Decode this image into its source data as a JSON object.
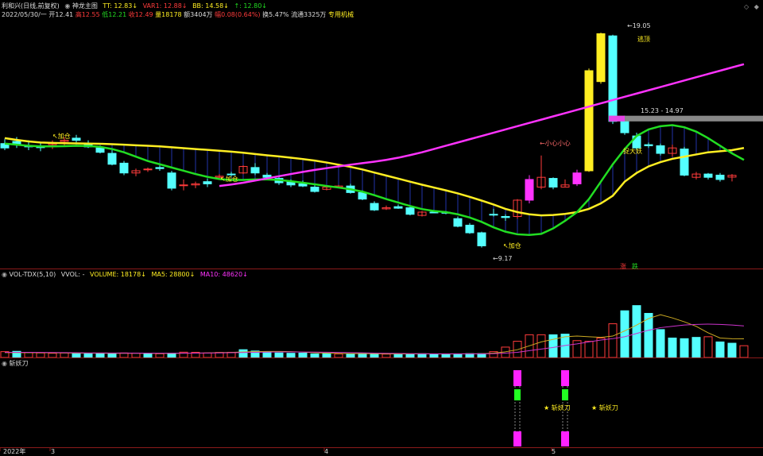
{
  "colors": {
    "up": "#ff3b3b",
    "down": "#54ffff",
    "ma_yellow": "#ffee22",
    "ma_green": "#22dd22",
    "ma_magenta": "#ff33ff",
    "white": "#dddddd",
    "orange": "#ffaa33",
    "gray": "#888888",
    "grid": "#8b1a1a"
  },
  "header": {
    "title": "利和兴(日线,前复权)",
    "indicator": "神龙主图",
    "tt": "TT: 12.83↓",
    "var1": "VAR1: 12.88↓",
    "bb": "BB: 14.58↓",
    "up_val": "↑: 12.80↓",
    "date": "2022/05/30/一",
    "open": "开12.41",
    "high": "高12.55",
    "low": "低12.21",
    "close": "收12.49",
    "vol": "量18178",
    "amount": "额3404万",
    "change": "幅0.08(0.64%)",
    "turnover": "换5.47%",
    "float": "流通3325万",
    "sector": "专用机械"
  },
  "window_icons": [
    "◇",
    "◆"
  ],
  "volume_header": {
    "name": "VOL-TDX(5,10)",
    "vvol": "VVOL: -",
    "volume": "VOLUME: 18178↓",
    "ma5": "MA5: 28800↓",
    "ma10": "MA10: 48620↓"
  },
  "signal_header": {
    "name": "斩妖刀"
  },
  "annotations": {
    "jiacang1": "↖加仓",
    "jiacang2": "↖加仓",
    "jiacang3": "↖加仓",
    "low_label": "←9.17",
    "high_label": "←19.05",
    "xiao_xin": "←小心小心",
    "taopao": "逃顶",
    "range_label": "15.23 - 14.97",
    "zhuo_da_yao": "捉大妖",
    "zhang": "涨",
    "die": "跌",
    "zhan1": "★ 斩妖刀",
    "zhan2": "★ 斩妖刀"
  },
  "x_axis": {
    "year": "2022年",
    "m3": "3",
    "m4": "4",
    "m5": "5"
  },
  "chart_data": [
    {
      "type": "candlestick",
      "title": "利和兴(日线,前复权)",
      "ylim": [
        8.5,
        19.6
      ],
      "candles": [
        {
          "o": 13.95,
          "h": 14.15,
          "l": 13.65,
          "c": 13.75
        },
        {
          "o": 14.05,
          "h": 14.25,
          "l": 13.75,
          "c": 13.9
        },
        {
          "o": 13.85,
          "h": 14.1,
          "l": 13.65,
          "c": 13.8
        },
        {
          "o": 13.8,
          "h": 14.0,
          "l": 13.6,
          "c": 13.78
        },
        {
          "o": 13.9,
          "h": 14.1,
          "l": 13.7,
          "c": 13.95
        },
        {
          "o": 14.05,
          "h": 14.25,
          "l": 13.85,
          "c": 14.1
        },
        {
          "o": 14.2,
          "h": 14.35,
          "l": 14.0,
          "c": 14.1
        },
        {
          "o": 13.95,
          "h": 14.1,
          "l": 13.75,
          "c": 13.8
        },
        {
          "o": 13.75,
          "h": 13.85,
          "l": 13.5,
          "c": 13.55
        },
        {
          "o": 13.5,
          "h": 13.65,
          "l": 12.95,
          "c": 13.0
        },
        {
          "o": 13.05,
          "h": 13.15,
          "l": 12.5,
          "c": 12.6
        },
        {
          "o": 12.6,
          "h": 12.8,
          "l": 12.45,
          "c": 12.7
        },
        {
          "o": 12.75,
          "h": 12.85,
          "l": 12.65,
          "c": 12.78
        },
        {
          "o": 12.85,
          "h": 12.95,
          "l": 12.7,
          "c": 12.8
        },
        {
          "o": 12.6,
          "h": 12.7,
          "l": 11.8,
          "c": 11.9
        },
        {
          "o": 12.05,
          "h": 12.3,
          "l": 11.8,
          "c": 12.05
        },
        {
          "o": 12.05,
          "h": 12.2,
          "l": 11.9,
          "c": 12.1
        },
        {
          "o": 12.2,
          "h": 12.35,
          "l": 11.95,
          "c": 12.1
        },
        {
          "o": 12.4,
          "h": 12.55,
          "l": 12.3,
          "c": 12.45
        },
        {
          "o": 12.55,
          "h": 12.65,
          "l": 12.45,
          "c": 12.52
        },
        {
          "o": 12.6,
          "h": 12.95,
          "l": 12.55,
          "c": 12.9
        },
        {
          "o": 12.85,
          "h": 13.05,
          "l": 12.5,
          "c": 12.6
        },
        {
          "o": 12.5,
          "h": 12.6,
          "l": 12.35,
          "c": 12.4
        },
        {
          "o": 12.35,
          "h": 12.45,
          "l": 12.05,
          "c": 12.15
        },
        {
          "o": 12.2,
          "h": 12.3,
          "l": 11.95,
          "c": 12.05
        },
        {
          "o": 12.1,
          "h": 12.25,
          "l": 11.95,
          "c": 12.0
        },
        {
          "o": 11.95,
          "h": 12.05,
          "l": 11.7,
          "c": 11.75
        },
        {
          "o": 11.85,
          "h": 12.0,
          "l": 11.8,
          "c": 11.95
        },
        {
          "o": 11.95,
          "h": 12.05,
          "l": 11.9,
          "c": 12.0
        },
        {
          "o": 12.0,
          "h": 12.1,
          "l": 11.65,
          "c": 11.7
        },
        {
          "o": 11.7,
          "h": 11.8,
          "l": 11.35,
          "c": 11.4
        },
        {
          "o": 11.2,
          "h": 11.3,
          "l": 10.85,
          "c": 10.9
        },
        {
          "o": 10.95,
          "h": 11.1,
          "l": 10.9,
          "c": 11.0
        },
        {
          "o": 11.05,
          "h": 11.15,
          "l": 10.95,
          "c": 10.98
        },
        {
          "o": 11.0,
          "h": 11.05,
          "l": 10.65,
          "c": 10.7
        },
        {
          "o": 10.65,
          "h": 10.85,
          "l": 10.6,
          "c": 10.8
        },
        {
          "o": 10.8,
          "h": 10.85,
          "l": 10.75,
          "c": 10.78
        },
        {
          "o": 10.8,
          "h": 10.85,
          "l": 10.7,
          "c": 10.75
        },
        {
          "o": 10.5,
          "h": 10.6,
          "l": 10.1,
          "c": 10.15
        },
        {
          "o": 10.2,
          "h": 10.3,
          "l": 9.8,
          "c": 9.85
        },
        {
          "o": 9.85,
          "h": 9.9,
          "l": 9.17,
          "c": 9.25
        },
        {
          "o": 10.7,
          "h": 10.95,
          "l": 10.6,
          "c": 10.68
        },
        {
          "o": 10.6,
          "h": 10.7,
          "l": 10.4,
          "c": 10.55
        },
        {
          "o": 10.6,
          "h": 11.4,
          "l": 10.5,
          "c": 11.35
        },
        {
          "o": 11.35,
          "h": 12.5,
          "l": 11.2,
          "c": 12.3
        },
        {
          "o": 11.95,
          "h": 13.4,
          "l": 11.85,
          "c": 12.4
        },
        {
          "o": 12.35,
          "h": 12.4,
          "l": 11.85,
          "c": 11.95
        },
        {
          "o": 11.95,
          "h": 12.3,
          "l": 11.95,
          "c": 12.05
        },
        {
          "o": 12.1,
          "h": 12.75,
          "l": 12.0,
          "c": 12.6
        },
        {
          "o": 12.7,
          "h": 17.4,
          "l": 12.65,
          "c": 17.3
        },
        {
          "o": 16.8,
          "h": 19.05,
          "l": 16.7,
          "c": 19.0
        },
        {
          "o": 18.9,
          "h": 18.95,
          "l": 14.85,
          "c": 14.97
        },
        {
          "o": 15.0,
          "h": 15.23,
          "l": 14.35,
          "c": 14.45
        },
        {
          "o": 14.3,
          "h": 14.45,
          "l": 13.65,
          "c": 13.75
        },
        {
          "o": 13.9,
          "h": 14.0,
          "l": 13.75,
          "c": 13.85
        },
        {
          "o": 13.85,
          "h": 13.95,
          "l": 13.4,
          "c": 13.5
        },
        {
          "o": 13.5,
          "h": 13.9,
          "l": 13.35,
          "c": 13.75
        },
        {
          "o": 13.7,
          "h": 13.8,
          "l": 12.45,
          "c": 12.5
        },
        {
          "o": 12.4,
          "h": 12.65,
          "l": 12.3,
          "c": 12.55
        },
        {
          "o": 12.55,
          "h": 12.6,
          "l": 12.3,
          "c": 12.4
        },
        {
          "o": 12.5,
          "h": 12.6,
          "l": 12.2,
          "c": 12.3
        },
        {
          "o": 12.41,
          "h": 12.55,
          "l": 12.21,
          "c": 12.49
        }
      ],
      "ma_yellow": [
        14.2,
        14.12,
        14.05,
        14.0,
        13.98,
        13.97,
        13.96,
        13.95,
        13.94,
        13.92,
        13.9,
        13.87,
        13.85,
        13.82,
        13.78,
        13.74,
        13.7,
        13.66,
        13.62,
        13.58,
        13.53,
        13.47,
        13.41,
        13.36,
        13.3,
        13.24,
        13.17,
        13.08,
        12.98,
        12.88,
        12.76,
        12.62,
        12.48,
        12.34,
        12.2,
        12.06,
        11.93,
        11.8,
        11.66,
        11.5,
        11.33,
        11.15,
        10.95,
        10.8,
        10.7,
        10.65,
        10.67,
        10.72,
        10.8,
        10.95,
        11.2,
        11.55,
        12.2,
        12.6,
        12.9,
        13.1,
        13.25,
        13.35,
        13.45,
        13.55,
        13.6,
        13.65,
        13.75
      ],
      "ma_green": [
        13.95,
        13.9,
        13.85,
        13.82,
        13.82,
        13.83,
        13.85,
        13.84,
        13.8,
        13.7,
        13.55,
        13.35,
        13.15,
        13.0,
        12.85,
        12.7,
        12.55,
        12.42,
        12.32,
        12.28,
        12.28,
        12.3,
        12.3,
        12.28,
        12.22,
        12.15,
        12.08,
        12.0,
        11.93,
        11.85,
        11.74,
        11.58,
        11.4,
        11.24,
        11.08,
        10.94,
        10.85,
        10.8,
        10.7,
        10.55,
        10.35,
        10.1,
        9.9,
        9.78,
        9.75,
        9.8,
        10.05,
        10.4,
        10.8,
        11.4,
        12.2,
        13.0,
        13.7,
        14.3,
        14.6,
        14.75,
        14.8,
        14.7,
        14.5,
        14.2,
        13.85,
        13.5,
        13.2
      ],
      "ma_magenta": [
        null,
        null,
        null,
        null,
        null,
        null,
        null,
        null,
        null,
        null,
        null,
        null,
        null,
        null,
        null,
        null,
        null,
        null,
        12.0,
        12.07,
        12.15,
        12.25,
        12.35,
        12.45,
        12.55,
        12.65,
        12.74,
        12.82,
        12.9,
        12.98,
        13.05,
        13.12,
        13.2,
        13.3,
        13.42,
        13.55,
        13.7,
        13.85,
        14.0,
        14.15,
        14.3,
        14.45,
        14.6,
        14.75,
        14.9,
        15.05,
        15.2,
        15.35,
        15.5,
        15.65,
        15.8,
        15.95,
        16.1,
        16.25,
        16.4,
        16.55,
        16.7,
        16.85,
        17.0,
        17.15,
        17.3,
        17.45,
        17.6
      ]
    },
    {
      "type": "bar",
      "title": "VOL-TDX(5,10)",
      "ylim": [
        0,
        120000
      ],
      "values": [
        9000,
        9500,
        7500,
        7000,
        6500,
        7000,
        6800,
        6500,
        6200,
        6000,
        7000,
        6800,
        5500,
        5800,
        6500,
        8200,
        8000,
        7000,
        7800,
        8000,
        12000,
        10000,
        8500,
        7000,
        6500,
        6800,
        5500,
        6000,
        5500,
        5500,
        6000,
        5800,
        5200,
        4800,
        5500,
        5800,
        5000,
        5200,
        5600,
        6000,
        6000,
        9000,
        16000,
        25000,
        35000,
        35000,
        35000,
        36000,
        26000,
        25000,
        30000,
        52000,
        72000,
        80000,
        68000,
        43000,
        30000,
        29000,
        31000,
        32000,
        24000,
        22000,
        18178
      ],
      "volume_up": [
        true,
        false,
        true,
        true,
        true,
        true,
        false,
        false,
        false,
        false,
        true,
        true,
        false,
        true,
        false,
        true,
        true,
        true,
        true,
        true,
        false,
        false,
        false,
        false,
        false,
        false,
        false,
        false,
        true,
        false,
        false,
        false,
        true,
        false,
        false,
        false,
        false,
        false,
        false,
        false,
        false,
        true,
        true,
        true,
        true,
        true,
        false,
        false,
        true,
        true,
        true,
        true,
        false,
        false,
        false,
        false,
        false,
        false,
        false,
        true,
        false,
        false,
        true
      ],
      "ma5": [
        7500,
        7500,
        7400,
        7300,
        7200,
        7000,
        6800,
        6700,
        6600,
        6500,
        6500,
        6500,
        6400,
        6300,
        6300,
        6600,
        6800,
        7000,
        7500,
        7800,
        8600,
        9000,
        9400,
        9300,
        9000,
        8200,
        7400,
        6800,
        6200,
        6000,
        5900,
        5800,
        5600,
        5500,
        5500,
        5600,
        5500,
        5400,
        5500,
        5700,
        5800,
        6800,
        8800,
        12000,
        18000,
        24000,
        28000,
        32000,
        33000,
        32000,
        31000,
        33000,
        41000,
        50000,
        60000,
        66000,
        61000,
        55000,
        48000,
        38000,
        30000,
        29000,
        28800
      ],
      "ma10": [
        8000,
        8000,
        7900,
        7800,
        7700,
        7500,
        7300,
        7100,
        7000,
        6900,
        6900,
        6800,
        6700,
        6600,
        6600,
        6700,
        6800,
        6900,
        7100,
        7400,
        7700,
        8000,
        8300,
        8500,
        8500,
        8400,
        8300,
        8100,
        7800,
        7500,
        7200,
        6800,
        6500,
        6200,
        6000,
        5800,
        5700,
        5600,
        5600,
        5600,
        5700,
        6000,
        6800,
        8000,
        10500,
        13000,
        15500,
        18500,
        21000,
        24000,
        27000,
        29000,
        32000,
        37000,
        42000,
        46000,
        48000,
        50000,
        51000,
        51500,
        51000,
        50000,
        48620
      ]
    },
    {
      "type": "signal",
      "title": "斩妖刀",
      "signal_bar_indices": [
        43,
        47
      ]
    }
  ]
}
